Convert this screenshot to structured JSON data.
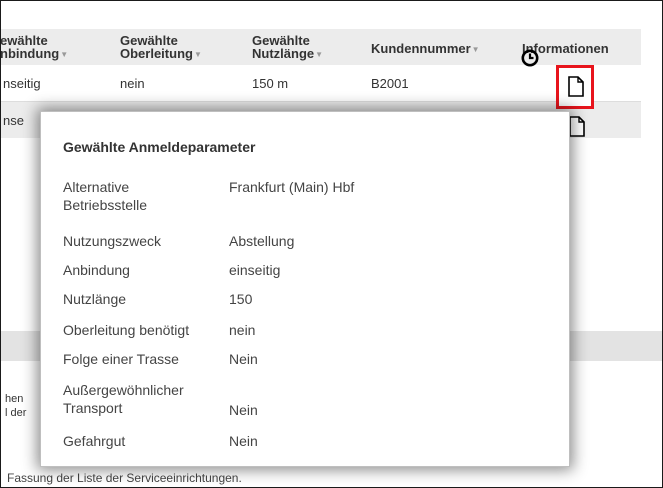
{
  "table": {
    "headers": [
      {
        "line1": "ewählte",
        "line2": "nbindung",
        "sortable": true
      },
      {
        "line1": "Gewählte",
        "line2": "Oberleitung",
        "sortable": true
      },
      {
        "line1": "Gewählte",
        "line2": "Nutzlänge",
        "sortable": true
      },
      {
        "line1": "Kundennummer",
        "line2": "",
        "sortable": true
      },
      {
        "line1": "Informationen",
        "line2": "",
        "sortable": false
      }
    ],
    "rows": [
      {
        "anbindung": "nseitig",
        "oberleitung": "nein",
        "nutzlaenge": "150 m",
        "kundennummer": "B2001"
      },
      {
        "anbindung": "nse",
        "oberleitung": "",
        "nutzlaenge": "",
        "kundennummer": ""
      }
    ]
  },
  "background_fragments": {
    "left1": "hen",
    "left2": "l der",
    "footer": "Fassung der Liste der Serviceeinrichtungen."
  },
  "popup": {
    "title": "Gewählte Anmeldeparameter",
    "rows": [
      {
        "label": "Alternative Betriebsstelle",
        "value": "Frankfurt (Main) Hbf"
      },
      {
        "label": "Nutzungszweck",
        "value": "Abstellung"
      },
      {
        "label": "Anbindung",
        "value": "einseitig"
      },
      {
        "label": "Nutzlänge",
        "value": "150"
      },
      {
        "label": "Oberleitung benötigt",
        "value": "nein"
      },
      {
        "label": "Folge einer Trasse",
        "value": "Nein"
      },
      {
        "label": "Außergewöhnlicher Transport",
        "value": "Nein"
      },
      {
        "label": "Gefahrgut",
        "value": "Nein"
      }
    ]
  },
  "colors": {
    "highlight": "#e8141c",
    "header_bg": "#ececec"
  },
  "icons": [
    "clock-icon",
    "document-icon"
  ]
}
